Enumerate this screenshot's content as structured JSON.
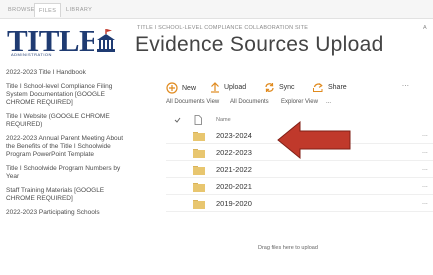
{
  "ribbon": {
    "tabs": [
      {
        "label": "BROWSE",
        "active": false
      },
      {
        "label": "FILES",
        "active": true
      },
      {
        "label": "LIBRARY",
        "active": false
      }
    ]
  },
  "logo": {
    "text": "TITLE",
    "sub": "ADMINISTRATION"
  },
  "leftnav": {
    "items": [
      "2022-2023 Title I Handbook",
      "Title I School-level Compliance Filing System Documentation [GOOGLE CHROME REQUIRED]",
      "Title I Website (GOOGLE CHROME REQUIRED)",
      "2022-2023 Annual Parent Meeting About the Benefits of the Title I Schoolwide Program PowerPoint Template",
      "Title I Schoolwide Program Numbers by Year",
      "Staff Training Materials [GOOGLE CHROME REQUIRED]",
      "2022-2023 Participating Schools"
    ]
  },
  "header": {
    "site_crumb": "TITLE I SCHOOL-LEVEL COMPLIANCE COLLABORATION SITE",
    "site_crumb_more": "A",
    "title": "Evidence Sources Upload"
  },
  "commands": {
    "new": "New",
    "upload": "Upload",
    "sync": "Sync",
    "share": "Share",
    "more": "..."
  },
  "views": {
    "all_documents_view": "All Documents View",
    "all_documents": "All Documents",
    "explorer_view": "Explorer View",
    "more": "..."
  },
  "list": {
    "name_header": "Name",
    "folders": [
      "2023-2024",
      "2022-2023",
      "2021-2022",
      "2020-2021",
      "2019-2020"
    ],
    "row_menu": "..."
  },
  "drag_hint": "Drag files here to upload",
  "colors": {
    "accent": "#0072c6",
    "logo": "#1f3b72",
    "folder": "#e8c66f",
    "arrow": "#c0392b"
  }
}
